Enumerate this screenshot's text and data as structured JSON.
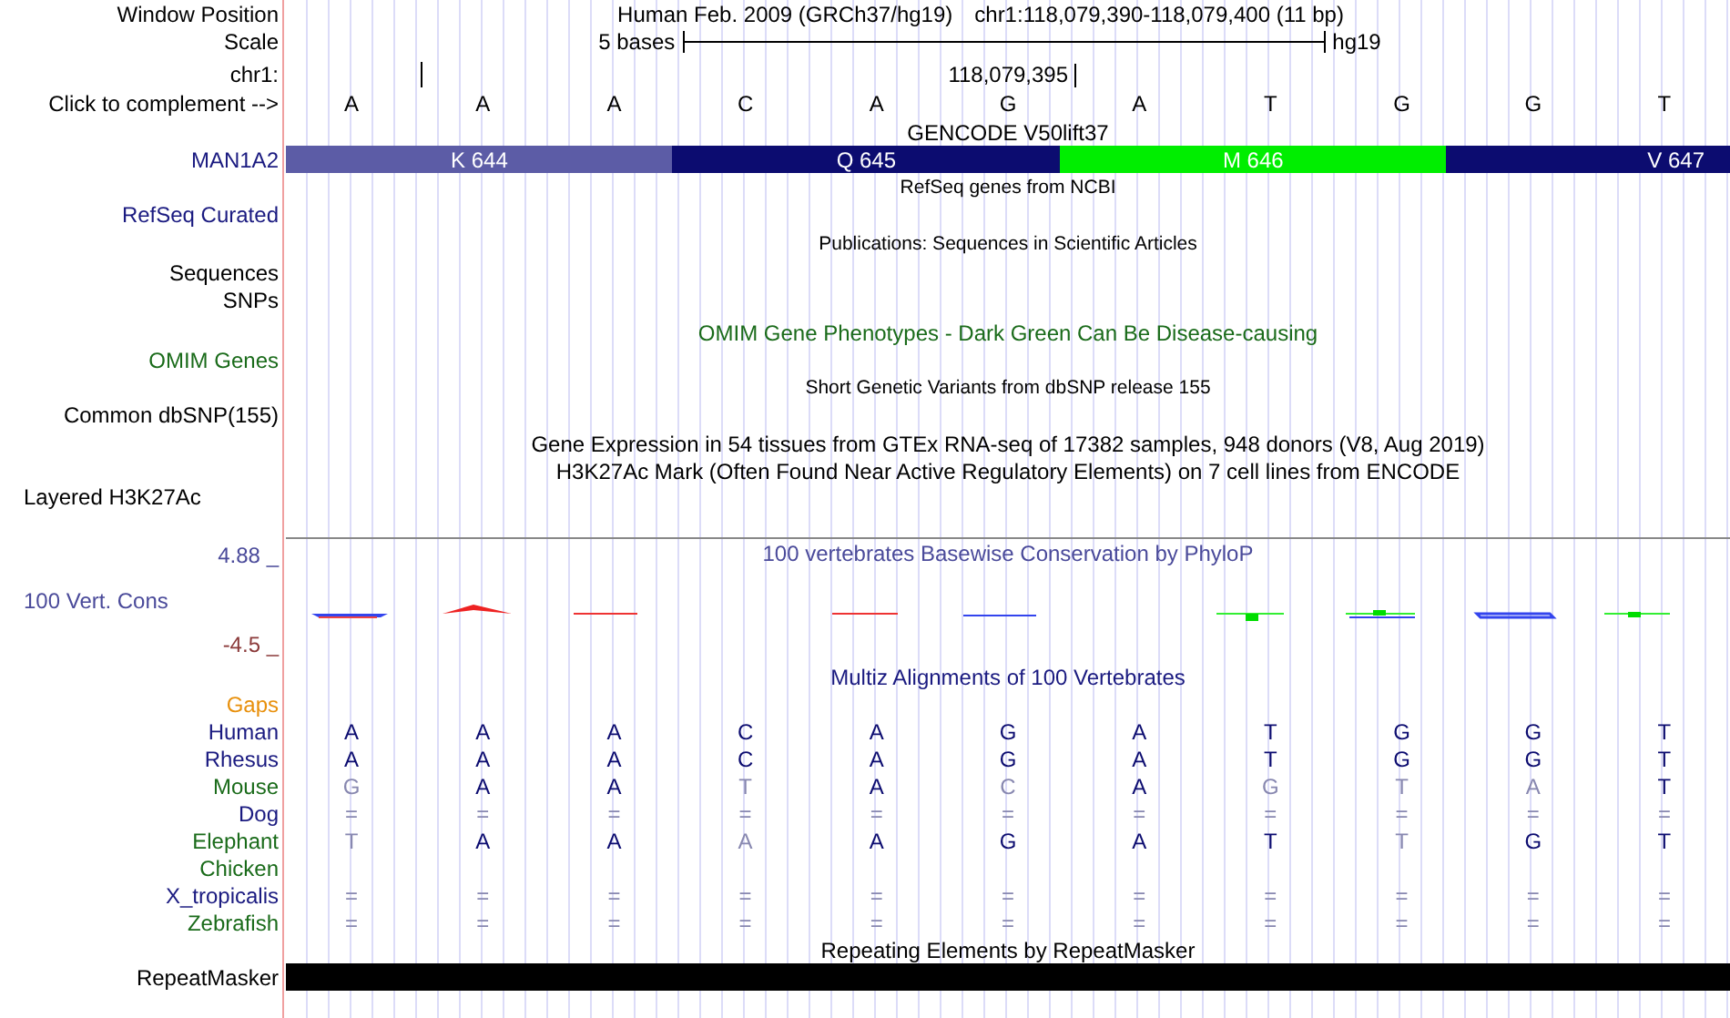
{
  "position_header": {
    "label": "Window Position",
    "assembly": "Human Feb. 2009 (GRCh37/hg19)",
    "position": "chr1:118,079,390-118,079,400 (11 bp)"
  },
  "scale": {
    "label": "Scale",
    "ruler_label": "5 bases",
    "assembly": "hg19"
  },
  "chrom": {
    "label": "chr1:",
    "coordinate": "118,079,395"
  },
  "complement": {
    "label": "Click to complement -->",
    "bases": [
      "A",
      "A",
      "A",
      "C",
      "A",
      "G",
      "A",
      "T",
      "G",
      "G",
      "T"
    ]
  },
  "gencode": {
    "title": "GENCODE V50lift37",
    "label": "MAN1A2",
    "codons": [
      {
        "label": "K 644",
        "color": "#5c5ca6"
      },
      {
        "label": "Q 645",
        "color": "#0c0c70"
      },
      {
        "label": "M 646",
        "color": "#00ee00"
      },
      {
        "label": "V 647",
        "color": "#0c0c70"
      }
    ]
  },
  "refseq": {
    "title": "RefSeq genes from NCBI",
    "label": "RefSeq Curated"
  },
  "publications": {
    "title": "Publications: Sequences in Scientific Articles",
    "labels": [
      "Sequences",
      "SNPs"
    ]
  },
  "omim": {
    "title": "OMIM Gene Phenotypes - Dark Green Can Be Disease-causing",
    "label": "OMIM Genes"
  },
  "dbsnp": {
    "title": "Short Genetic Variants from dbSNP release 155",
    "label": "Common dbSNP(155)"
  },
  "gtex": {
    "title": "Gene Expression in 54 tissues from GTEx RNA-seq of 17382 samples, 948 donors (V8, Aug 2019)"
  },
  "h3k27ac": {
    "title": "H3K27Ac Mark (Often Found Near Active Regulatory Elements) on 7 cell lines from ENCODE",
    "label": "Layered H3K27Ac"
  },
  "conservation": {
    "title": "100 vertebrates Basewise Conservation by PhyloP",
    "label": "100 Vert. Cons",
    "max": "4.88 _",
    "min": "-4.5 _"
  },
  "multiz": {
    "title": "Multiz Alignments of 100 Vertebrates",
    "gaps_label": "Gaps",
    "species": [
      {
        "name": "Human",
        "color": "#1a1a80",
        "bases": [
          {
            "text": "A",
            "faded": false
          },
          {
            "text": "A",
            "faded": false
          },
          {
            "text": "A",
            "faded": false
          },
          {
            "text": "C",
            "faded": false
          },
          {
            "text": "A",
            "faded": false
          },
          {
            "text": "G",
            "faded": false
          },
          {
            "text": "A",
            "faded": false
          },
          {
            "text": "T",
            "faded": false
          },
          {
            "text": "G",
            "faded": false
          },
          {
            "text": "G",
            "faded": false
          },
          {
            "text": "T",
            "faded": false
          }
        ]
      },
      {
        "name": "Rhesus",
        "color": "#1a1a80",
        "bases": [
          {
            "text": "A",
            "faded": false
          },
          {
            "text": "A",
            "faded": false
          },
          {
            "text": "A",
            "faded": false
          },
          {
            "text": "C",
            "faded": false
          },
          {
            "text": "A",
            "faded": false
          },
          {
            "text": "G",
            "faded": false
          },
          {
            "text": "A",
            "faded": false
          },
          {
            "text": "T",
            "faded": false
          },
          {
            "text": "G",
            "faded": false
          },
          {
            "text": "G",
            "faded": false
          },
          {
            "text": "T",
            "faded": false
          }
        ]
      },
      {
        "name": "Mouse",
        "color": "#1a6b1a",
        "bases": [
          {
            "text": "G",
            "faded": true
          },
          {
            "text": "A",
            "faded": false
          },
          {
            "text": "A",
            "faded": false
          },
          {
            "text": "T",
            "faded": true
          },
          {
            "text": "A",
            "faded": false
          },
          {
            "text": "C",
            "faded": true
          },
          {
            "text": "A",
            "faded": false
          },
          {
            "text": "G",
            "faded": true
          },
          {
            "text": "T",
            "faded": true
          },
          {
            "text": "A",
            "faded": true
          },
          {
            "text": "T",
            "faded": false
          }
        ]
      },
      {
        "name": "Dog",
        "color": "#1a1a80",
        "bases": [
          {
            "text": "=",
            "faded": true
          },
          {
            "text": "=",
            "faded": true
          },
          {
            "text": "=",
            "faded": true
          },
          {
            "text": "=",
            "faded": true
          },
          {
            "text": "=",
            "faded": true
          },
          {
            "text": "=",
            "faded": true
          },
          {
            "text": "=",
            "faded": true
          },
          {
            "text": "=",
            "faded": true
          },
          {
            "text": "=",
            "faded": true
          },
          {
            "text": "=",
            "faded": true
          },
          {
            "text": "=",
            "faded": true
          }
        ]
      },
      {
        "name": "Elephant",
        "color": "#1a6b1a",
        "bases": [
          {
            "text": "T",
            "faded": true
          },
          {
            "text": "A",
            "faded": false
          },
          {
            "text": "A",
            "faded": false
          },
          {
            "text": "A",
            "faded": true
          },
          {
            "text": "A",
            "faded": false
          },
          {
            "text": "G",
            "faded": false
          },
          {
            "text": "A",
            "faded": false
          },
          {
            "text": "T",
            "faded": false
          },
          {
            "text": "T",
            "faded": true
          },
          {
            "text": "G",
            "faded": false
          },
          {
            "text": "T",
            "faded": false
          }
        ]
      },
      {
        "name": "Chicken",
        "color": "#1a6b1a"
      },
      {
        "name": "X_tropicalis",
        "color": "#1a1a80",
        "bases": [
          {
            "text": "=",
            "faded": true
          },
          {
            "text": "=",
            "faded": true
          },
          {
            "text": "=",
            "faded": true
          },
          {
            "text": "=",
            "faded": true
          },
          {
            "text": "=",
            "faded": true
          },
          {
            "text": "=",
            "faded": true
          },
          {
            "text": "=",
            "faded": true
          },
          {
            "text": "=",
            "faded": true
          },
          {
            "text": "=",
            "faded": true
          },
          {
            "text": "=",
            "faded": true
          },
          {
            "text": "=",
            "faded": true
          }
        ]
      },
      {
        "name": "Zebrafish",
        "color": "#1a6b1a",
        "bases": [
          {
            "text": "=",
            "faded": true
          },
          {
            "text": "=",
            "faded": true
          },
          {
            "text": "=",
            "faded": true
          },
          {
            "text": "=",
            "faded": true
          },
          {
            "text": "=",
            "faded": true
          },
          {
            "text": "=",
            "faded": true
          },
          {
            "text": "=",
            "faded": true
          },
          {
            "text": "=",
            "faded": true
          },
          {
            "text": "=",
            "faded": true
          },
          {
            "text": "=",
            "faded": true
          },
          {
            "text": "=",
            "faded": true
          }
        ]
      }
    ]
  },
  "repeatmasker": {
    "title": "Repeating Elements by RepeatMasker",
    "label": "RepeatMasker"
  }
}
